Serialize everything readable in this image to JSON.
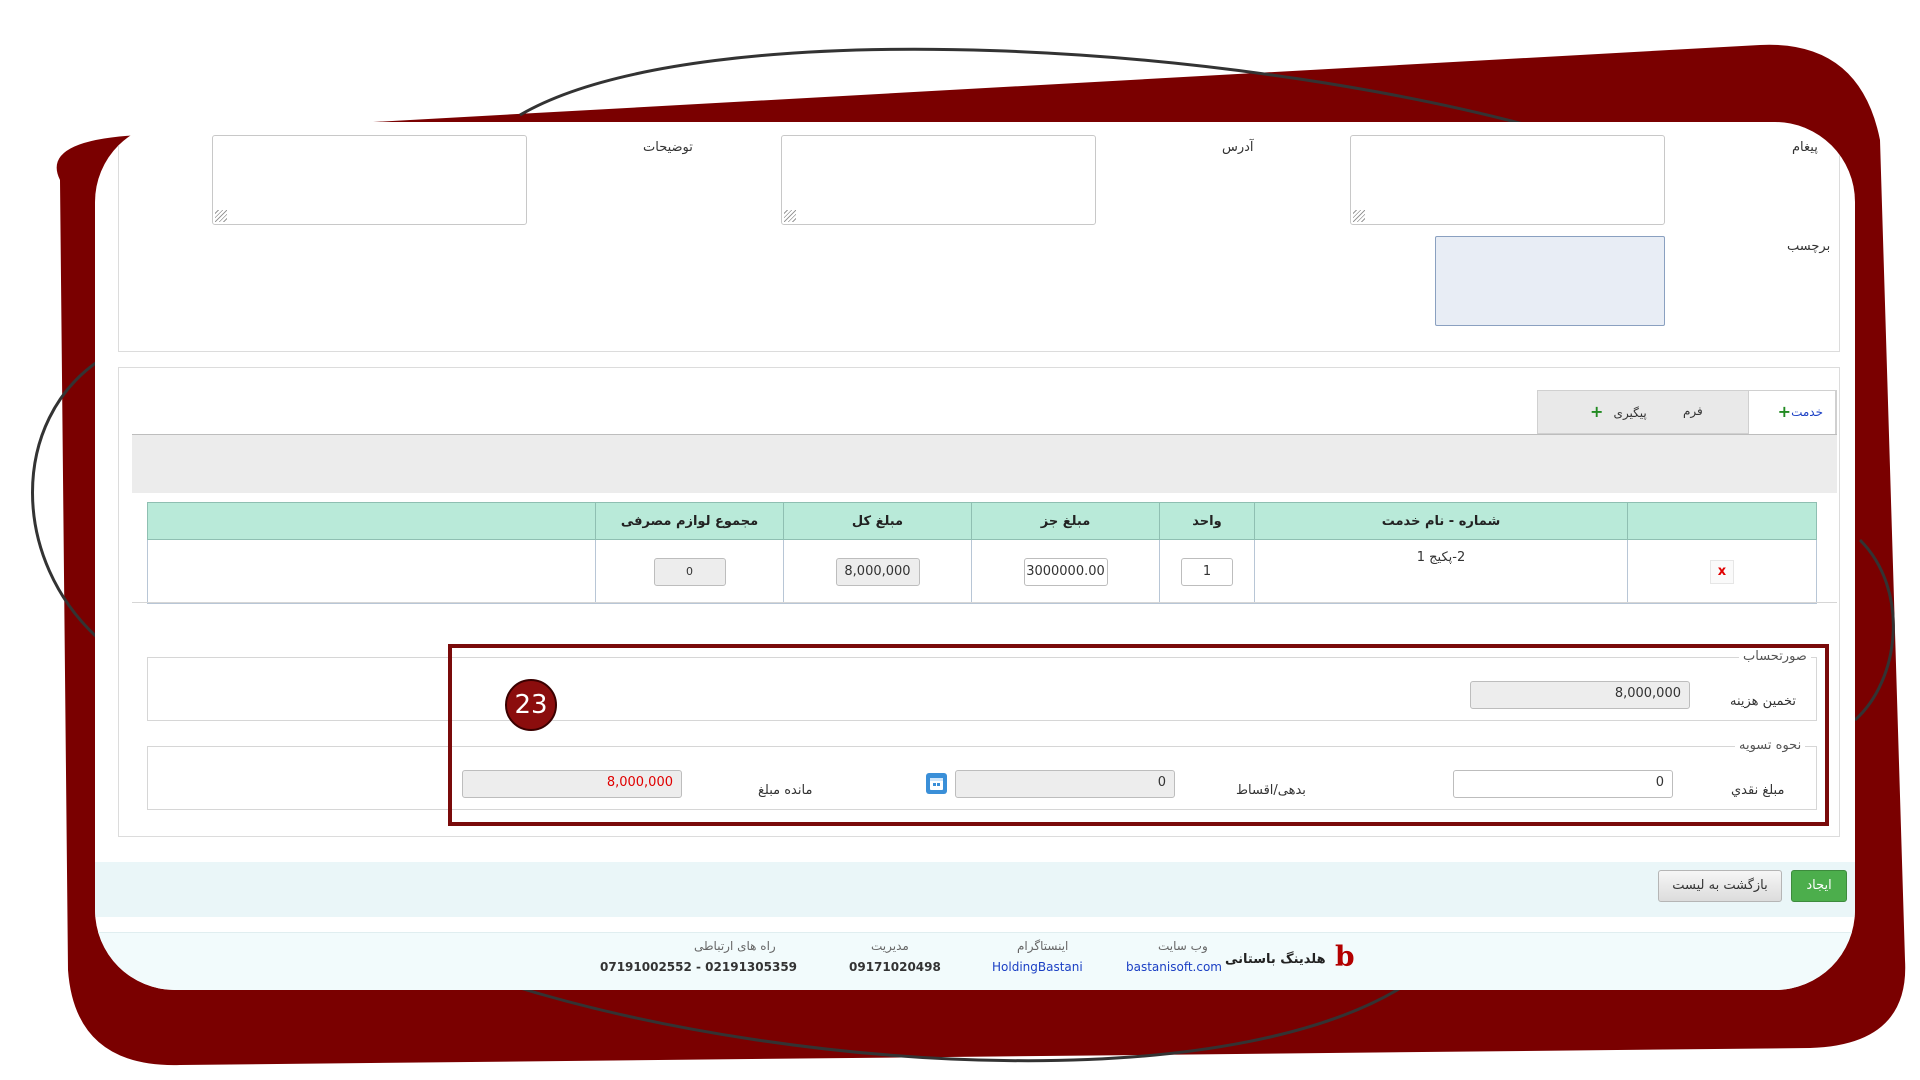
{
  "form": {
    "message_label": "پیغام",
    "address_label": "آدرس",
    "description_label": "توضیحات",
    "tag_label": "برچسب"
  },
  "tabs": [
    {
      "label": "خدمت",
      "icon": "plus-icon",
      "active": true
    },
    {
      "label": "فرم",
      "active": false
    },
    {
      "label": "پیگیری",
      "icon": "plus-icon",
      "active": false
    }
  ],
  "service_table": {
    "headers": [
      "",
      "شماره - نام خدمت",
      "واحد",
      "مبلغ جز",
      "مبلغ کل",
      "مجموع لوازم مصرفی",
      ""
    ],
    "rows": [
      {
        "delete": "x",
        "name": "2-پکیج 1",
        "unit": "1",
        "unit_price": "3000000.00",
        "total": "8,000,000",
        "consumables": "0"
      }
    ]
  },
  "invoice": {
    "legend": "صورتحساب",
    "cost_estimate_label": "تخمین هزینه",
    "cost_estimate_value": "8,000,000"
  },
  "settlement": {
    "legend": "نحوه تسویه",
    "cash_label": "مبلغ نقدي",
    "cash_value": "0",
    "debt_label": "بدهی/اقساط",
    "debt_value": "0",
    "remaining_label": "مانده مبلغ",
    "remaining_value": "8,000,000"
  },
  "badge": {
    "number": "23"
  },
  "actions": {
    "create_label": "ایجاد",
    "back_label": "بازگشت به لیست"
  },
  "footer": {
    "brand": "هلدینگ باستانی",
    "website_title": "وب سایت",
    "website_value": "bastanisoft.com",
    "instagram_title": "اینستاگرام",
    "instagram_value": "HoldingBastani",
    "management_title": "مدیریت",
    "management_value": "09171020498",
    "contact_title": "راه های ارتباطی",
    "contact_value": "07191002552 - 02191305359"
  },
  "colors": {
    "frame": "#7a0000",
    "badge": "#8b0d0d",
    "highlight_border": "#7a0a0a",
    "table_header": "#b9ead9",
    "create_button": "#4cae4c",
    "remaining_text": "#e00000",
    "link": "#1a3fc4"
  }
}
